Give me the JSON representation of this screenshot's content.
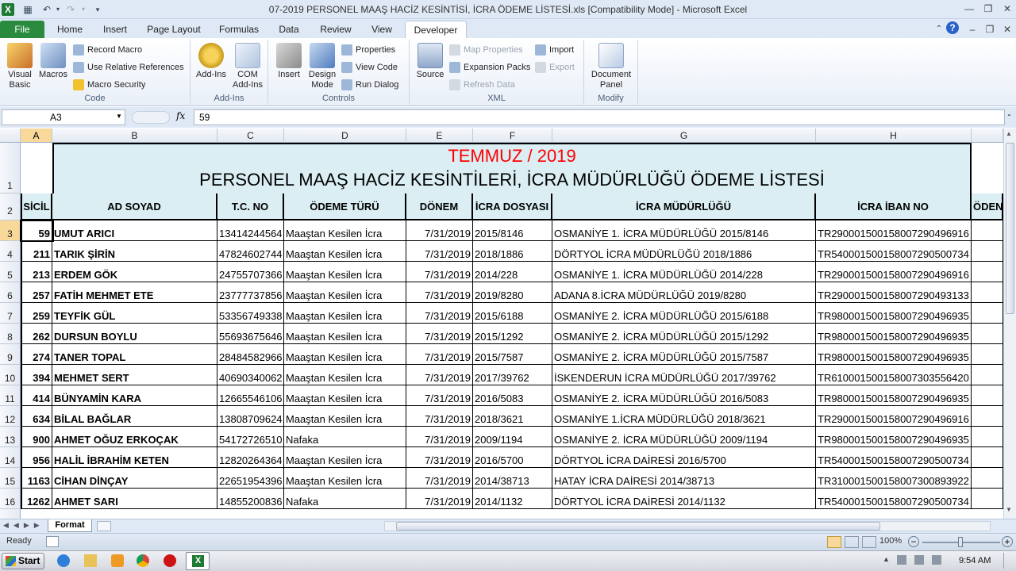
{
  "window": {
    "title": "07-2019 PERSONEL MAAŞ HACİZ KESİNTİSİ, İCRA ÖDEME LİSTESİ.xls  [Compatibility Mode]  -  Microsoft Excel",
    "accent": "#2a8a3e"
  },
  "tabs": [
    "File",
    "Home",
    "Insert",
    "Page Layout",
    "Formulas",
    "Data",
    "Review",
    "View",
    "Developer"
  ],
  "ribbon": {
    "code": {
      "visual_basic": "Visual Basic",
      "macros": "Macros",
      "record_macro": "Record Macro",
      "relative_refs": "Use Relative References",
      "macro_security": "Macro Security",
      "group": "Code"
    },
    "addins": {
      "addins": "Add-Ins",
      "com_addins": "COM Add-Ins",
      "group": "Add-Ins"
    },
    "controls": {
      "insert": "Insert",
      "design_mode": "Design Mode",
      "properties": "Properties",
      "view_code": "View Code",
      "run_dialog": "Run Dialog",
      "group": "Controls"
    },
    "xml": {
      "source": "Source",
      "map_properties": "Map Properties",
      "expansion_packs": "Expansion Packs",
      "refresh_data": "Refresh Data",
      "import": "Import",
      "export": "Export",
      "group": "XML"
    },
    "modify": {
      "document_panel": "Document Panel",
      "group": "Modify"
    }
  },
  "formula_bar": {
    "name_box": "A3",
    "fx": "fx",
    "value": "59"
  },
  "sheet": {
    "col_letters": [
      "A",
      "B",
      "C",
      "D",
      "E",
      "F",
      "G",
      "H"
    ],
    "title_line1": "TEMMUZ / 2019",
    "title_line2": "PERSONEL MAAŞ HACİZ KESİNTİLERİ, İCRA MÜDÜRLÜĞÜ ÖDEME LİSTESİ",
    "headers": [
      "SİCİL",
      "AD SOYAD",
      "T.C. NO",
      "ÖDEME TÜRÜ",
      "DÖNEM",
      "İCRA DOSYASI",
      "İCRA MÜDÜRLÜĞÜ",
      "İCRA İBAN NO",
      "ÖDEN"
    ],
    "rows": [
      [
        "59",
        "UMUT ARICI",
        "13414244564",
        "Maaştan Kesilen İcra",
        "7/31/2019",
        "2015/8146",
        "OSMANİYE 1. İCRA MÜDÜRLÜĞÜ 2015/8146",
        "TR290001500158007290496916"
      ],
      [
        "211",
        "TARIK ŞİRİN",
        "47824602744",
        "Maaştan Kesilen İcra",
        "7/31/2019",
        "2018/1886",
        "DÖRTYOL İCRA MÜDÜRLÜĞÜ 2018/1886",
        "TR540001500158007290500734"
      ],
      [
        "213",
        "ERDEM GÖK",
        "24755707366",
        "Maaştan Kesilen İcra",
        "7/31/2019",
        "2014/228",
        "OSMANİYE 1. İCRA MÜDÜRLÜĞÜ 2014/228",
        "TR290001500158007290496916"
      ],
      [
        "257",
        "FATİH MEHMET ETE",
        "23777737856",
        "Maaştan Kesilen İcra",
        "7/31/2019",
        "2019/8280",
        "ADANA 8.İCRA MÜDÜRLÜĞÜ 2019/8280",
        "TR290001500158007290493133"
      ],
      [
        "259",
        "TEYFİK GÜL",
        "53356749338",
        "Maaştan Kesilen İcra",
        "7/31/2019",
        "2015/6188",
        "OSMANİYE 2. İCRA MÜDÜRLÜĞÜ 2015/6188",
        "TR980001500158007290496935"
      ],
      [
        "262",
        "DURSUN BOYLU",
        "55693675646",
        "Maaştan Kesilen İcra",
        "7/31/2019",
        "2015/1292",
        "OSMANİYE 2. İCRA MÜDÜRLÜĞÜ 2015/1292",
        "TR980001500158007290496935"
      ],
      [
        "274",
        "TANER TOPAL",
        "28484582966",
        "Maaştan Kesilen İcra",
        "7/31/2019",
        "2015/7587",
        "OSMANİYE 2. İCRA MÜDÜRLÜĞÜ 2015/7587",
        "TR980001500158007290496935"
      ],
      [
        "394",
        "MEHMET SERT",
        "40690340062",
        "Maaştan Kesilen İcra",
        "7/31/2019",
        "2017/39762",
        "İSKENDERUN İCRA MÜDÜRLÜĞÜ 2017/39762",
        "TR610001500158007303556420"
      ],
      [
        "414",
        "BÜNYAMİN KARA",
        "12665546106",
        "Maaştan Kesilen İcra",
        "7/31/2019",
        "2016/5083",
        "OSMANİYE 2. İCRA MÜDÜRLÜĞÜ 2016/5083",
        "TR980001500158007290496935"
      ],
      [
        "634",
        "BİLAL BAĞLAR",
        "13808709624",
        "Maaştan Kesilen İcra",
        "7/31/2019",
        "2018/3621",
        "OSMANİYE 1.İCRA MÜDÜRLÜĞÜ 2018/3621",
        "TR290001500158007290496916"
      ],
      [
        "900",
        "AHMET OĞUZ ERKOÇAK",
        "54172726510",
        "Nafaka",
        "7/31/2019",
        "2009/1194",
        "OSMANİYE 2. İCRA MÜDÜRLÜĞÜ 2009/1194",
        "TR980001500158007290496935"
      ],
      [
        "956",
        "HALİL İBRAHİM KETEN",
        "12820264364",
        "Maaştan Kesilen İcra",
        "7/31/2019",
        "2016/5700",
        "DÖRTYOL İCRA DAİRESİ 2016/5700",
        "TR540001500158007290500734"
      ],
      [
        "1163",
        "CİHAN DİNÇAY",
        "22651954396",
        "Maaştan Kesilen İcra",
        "7/31/2019",
        "2014/38713",
        "HATAY İCRA DAİRESİ 2014/38713",
        "TR310001500158007300893922"
      ],
      [
        "1262",
        "AHMET SARI",
        "14855200836",
        "Nafaka",
        "7/31/2019",
        "2014/1132",
        "DÖRTYOL İCRA DAİRESİ 2014/1132",
        "TR540001500158007290500734"
      ]
    ],
    "sheet_tab": "Format"
  },
  "status": {
    "ready": "Ready",
    "zoom": "100%"
  },
  "taskbar": {
    "start": "Start",
    "clock": "9:54 AM"
  },
  "colors": {
    "title_red": "#ff0000",
    "header_fill": "#daeef3",
    "selected": "#f9d99a"
  }
}
